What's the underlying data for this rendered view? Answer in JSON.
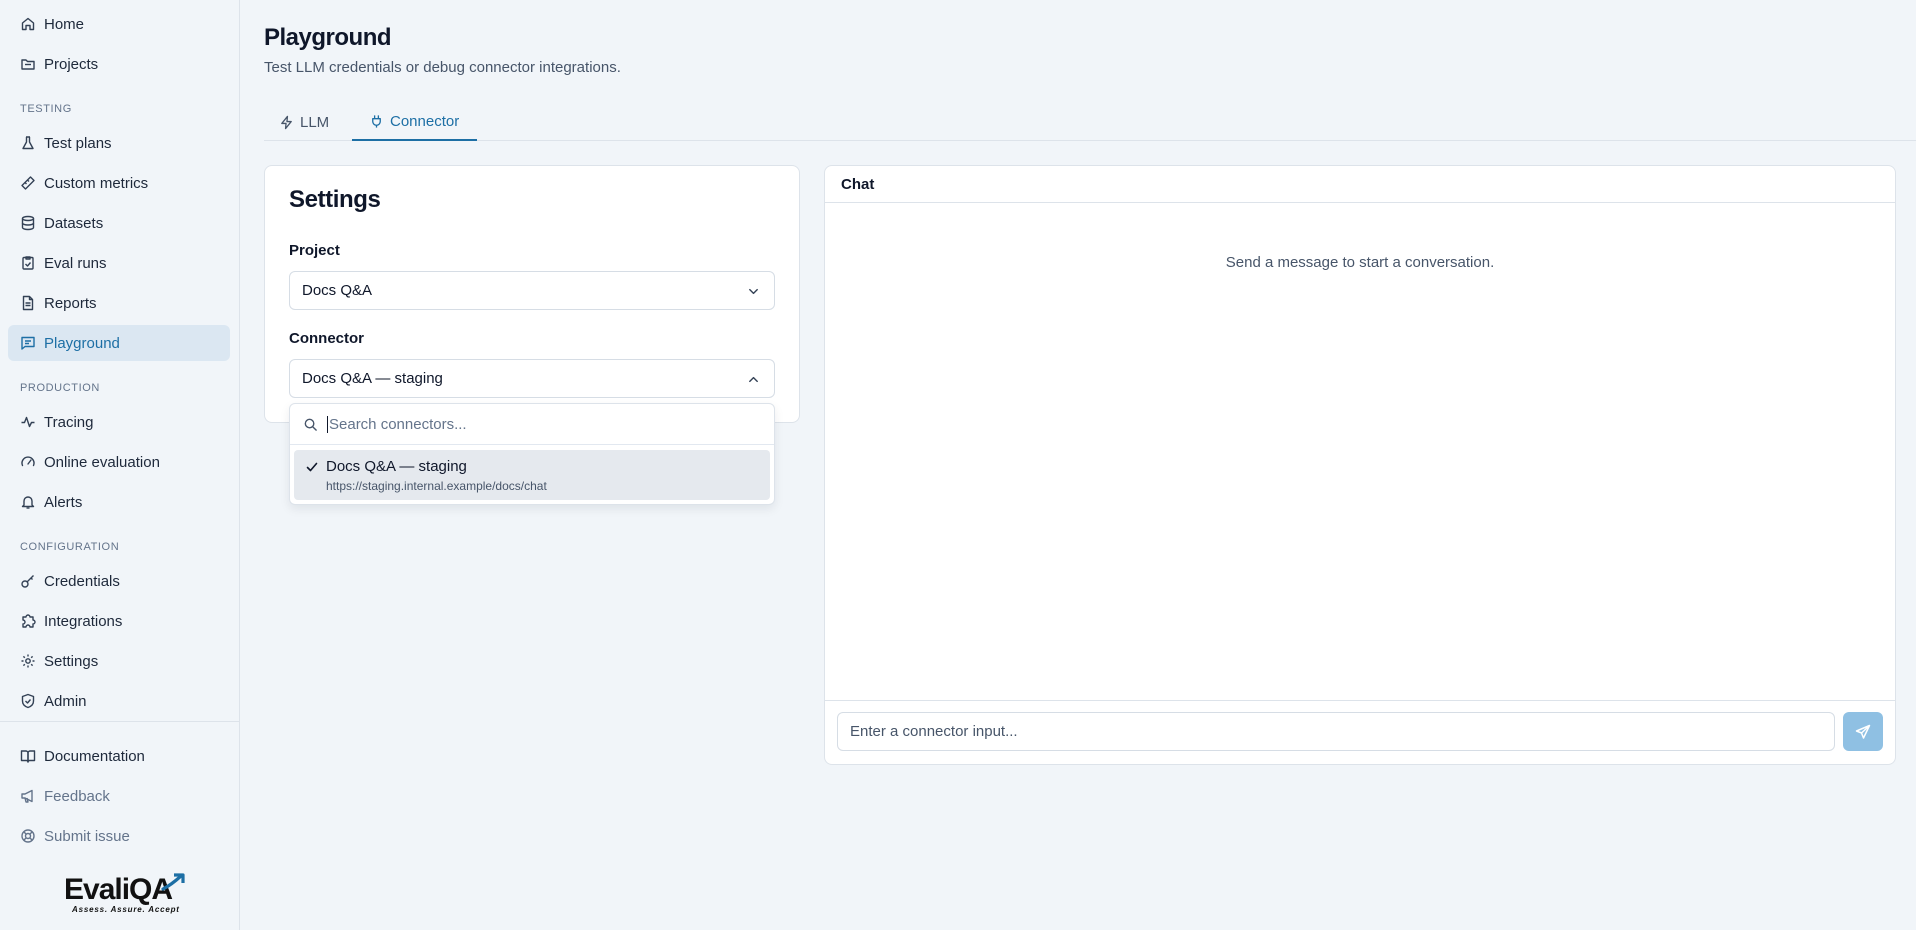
{
  "sidebar": {
    "items": [
      {
        "label": "Home",
        "icon": "home-icon"
      },
      {
        "label": "Projects",
        "icon": "folder-icon"
      },
      {
        "label": "Test plans",
        "icon": "flask-icon"
      },
      {
        "label": "Custom metrics",
        "icon": "ruler-icon"
      },
      {
        "label": "Datasets",
        "icon": "database-icon"
      },
      {
        "label": "Eval runs",
        "icon": "clipboard-check-icon"
      },
      {
        "label": "Reports",
        "icon": "file-text-icon"
      },
      {
        "label": "Playground",
        "icon": "message-square-icon",
        "active": true
      },
      {
        "label": "Tracing",
        "icon": "activity-icon"
      },
      {
        "label": "Online evaluation",
        "icon": "gauge-icon"
      },
      {
        "label": "Alerts",
        "icon": "bell-icon"
      },
      {
        "label": "Credentials",
        "icon": "key-icon"
      },
      {
        "label": "Integrations",
        "icon": "puzzle-icon"
      },
      {
        "label": "Settings",
        "icon": "gear-icon"
      },
      {
        "label": "Admin",
        "icon": "shield-check-icon"
      }
    ],
    "sections": {
      "testing": "TESTING",
      "production": "PRODUCTION",
      "configuration": "CONFIGURATION"
    },
    "footer_items": [
      {
        "label": "Documentation",
        "icon": "book-icon"
      },
      {
        "label": "Feedback",
        "icon": "megaphone-icon"
      },
      {
        "label": "Submit issue",
        "icon": "lifebuoy-icon"
      }
    ],
    "logo": {
      "text": "EvaliQA",
      "tagline": "Assess. Assure. Accept"
    }
  },
  "header": {
    "title": "Playground",
    "subtitle": "Test LLM credentials or debug connector integrations."
  },
  "tabs": [
    {
      "label": "LLM",
      "icon": "zap-icon",
      "active": false
    },
    {
      "label": "Connector",
      "icon": "plug-icon",
      "active": true
    }
  ],
  "settings": {
    "title": "Settings",
    "project_label": "Project",
    "project_value": "Docs Q&A",
    "connector_label": "Connector",
    "connector_value": "Docs Q&A — staging"
  },
  "dropdown": {
    "search_placeholder": "Search connectors...",
    "options": [
      {
        "name": "Docs Q&A — staging",
        "url": "https://staging.internal.example/docs/chat",
        "selected": true
      }
    ]
  },
  "chat": {
    "title": "Chat",
    "empty_text": "Send a message to start a conversation.",
    "input_placeholder": "Enter a connector input...",
    "send_icon": "send-icon"
  },
  "colors": {
    "accent": "#1d6fa5",
    "background": "#f1f5f9",
    "active_nav_bg": "#dbe7f2",
    "send_button": "#8fc0e3"
  }
}
